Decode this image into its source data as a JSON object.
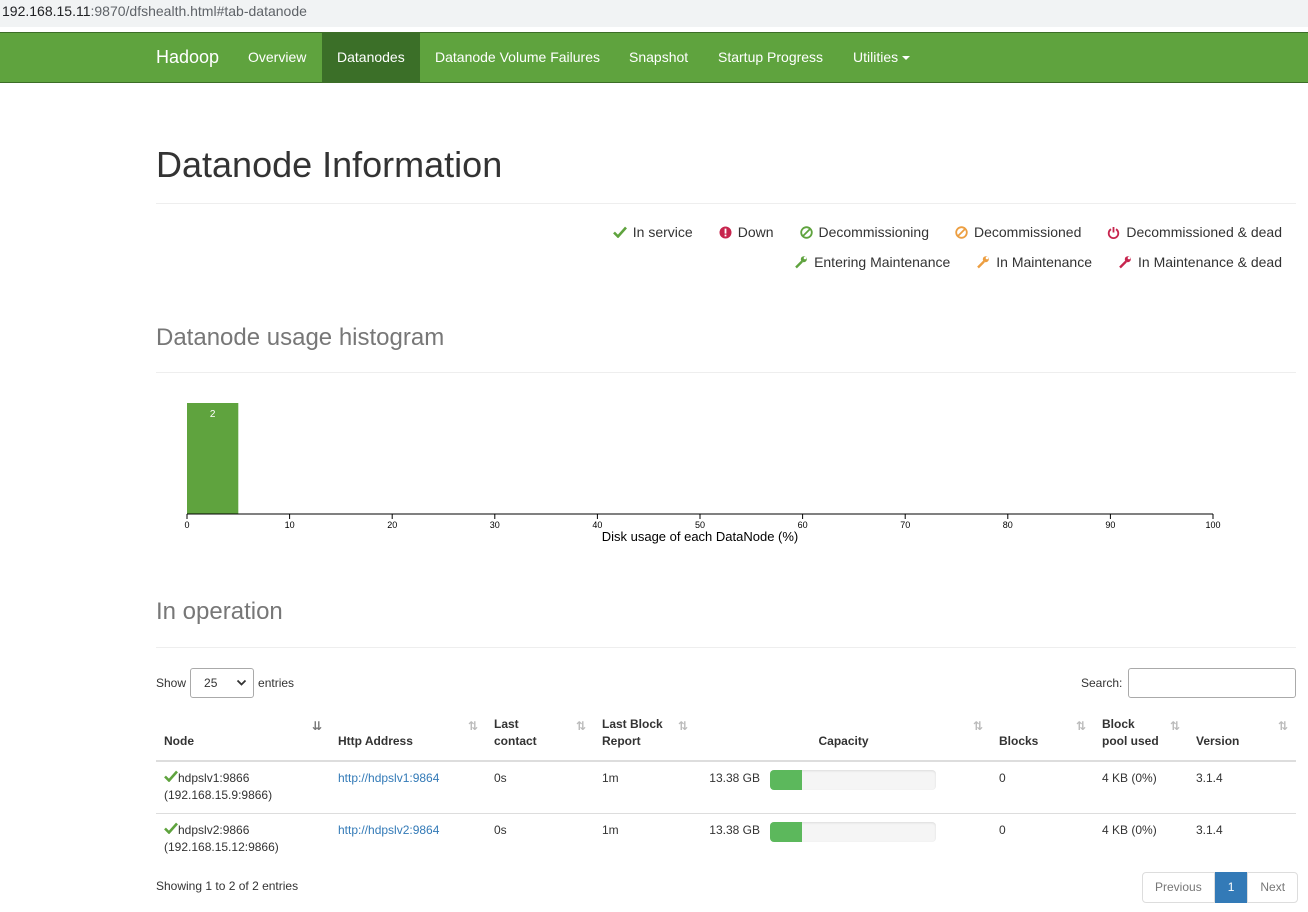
{
  "browser": {
    "url_host": "192.168.15.11",
    "url_rest": ":9870/dfshealth.html#tab-datanode"
  },
  "navbar": {
    "brand": "Hadoop",
    "items": [
      "Overview",
      "Datanodes",
      "Datanode Volume Failures",
      "Snapshot",
      "Startup Progress",
      "Utilities"
    ],
    "active": "Datanodes"
  },
  "page": {
    "title": "Datanode Information",
    "histogram_heading": "Datanode usage histogram",
    "operation_heading": "In operation"
  },
  "legend": {
    "row1": [
      "In service",
      "Down",
      "Decommissioning",
      "Decommissioned",
      "Decommissioned & dead"
    ],
    "row2": [
      "Entering Maintenance",
      "In Maintenance",
      "In Maintenance & dead"
    ],
    "colors": {
      "green": "#5fa33e",
      "red": "#c7254e",
      "orange": "#ec9e41"
    }
  },
  "chart_data": {
    "type": "bar",
    "bins": [
      [
        0,
        5
      ]
    ],
    "values": [
      2
    ],
    "data_labels": [
      "2"
    ],
    "xlabel": "Disk usage of each DataNode (%)",
    "xticks": [
      "0",
      "10",
      "20",
      "30",
      "40",
      "50",
      "60",
      "70",
      "80",
      "90",
      "100"
    ],
    "xlim": [
      0,
      100
    ],
    "bar_color": "#5fa33e"
  },
  "table": {
    "show_label": "Show",
    "entries_value": "25",
    "entries_label": "entries",
    "search_label": "Search:",
    "headers": [
      "Node",
      "Http Address",
      "Last contact",
      "Last Block Report",
      "Capacity",
      "Blocks",
      "Block pool used",
      "Version"
    ],
    "header_lines": {
      "last_contact": [
        "Last",
        "contact"
      ],
      "last_block_report": [
        "Last Block",
        "Report"
      ],
      "block_pool_used": [
        "Block",
        "pool used"
      ]
    },
    "rows": [
      {
        "node": "hdpslv1:9866",
        "node_ip": "(192.168.15.9:9866)",
        "http": "http://hdpslv1:9864",
        "last_contact": "0s",
        "last_block_report": "1m",
        "capacity": "13.38 GB",
        "used_fraction": 0.19,
        "blocks": "0",
        "block_pool_used": "4 KB (0%)",
        "version": "3.1.4"
      },
      {
        "node": "hdpslv2:9866",
        "node_ip": "(192.168.15.12:9866)",
        "http": "http://hdpslv2:9864",
        "last_contact": "0s",
        "last_block_report": "1m",
        "capacity": "13.38 GB",
        "used_fraction": 0.19,
        "blocks": "0",
        "block_pool_used": "4 KB (0%)",
        "version": "3.1.4"
      }
    ],
    "info": "Showing 1 to 2 of 2 entries",
    "pager": {
      "previous": "Previous",
      "current": "1",
      "next": "Next"
    }
  }
}
